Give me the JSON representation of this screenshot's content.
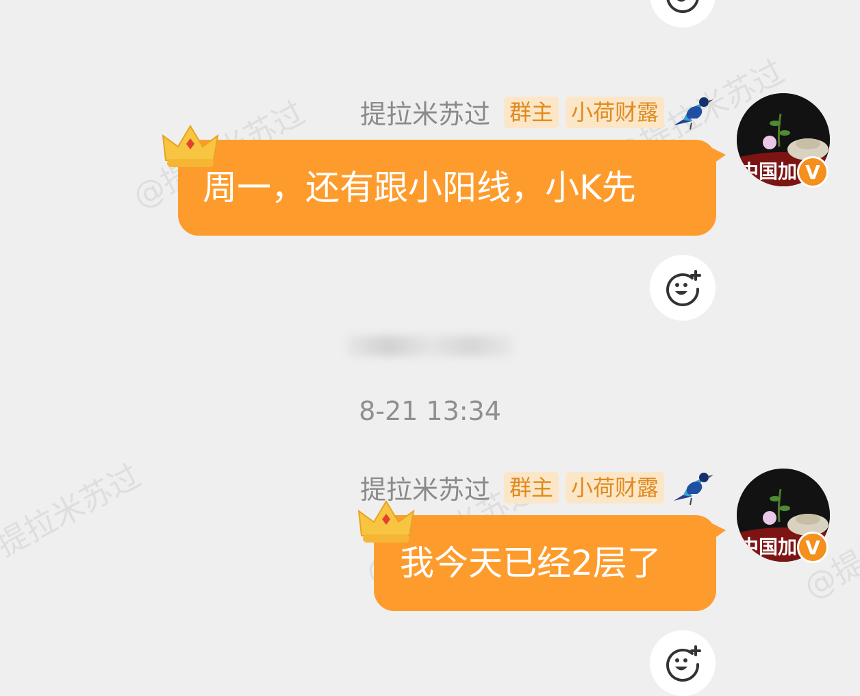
{
  "watermark": "@提拉米苏过",
  "messages": [
    {
      "sender": "提拉米苏过",
      "badge_role": "群主",
      "badge_group": "小荷财露",
      "text": "周一，还有跟小阳线，小K先",
      "avatar_caption": "中国加",
      "verified_mark": "V"
    },
    {
      "sender": "提拉米苏过",
      "badge_role": "群主",
      "badge_group": "小荷财露",
      "text": "我今天已经2层了",
      "avatar_caption": "中国加",
      "verified_mark": "V"
    }
  ],
  "timestamp": "8-21 13:34",
  "icons": {
    "reaction": "add-emoji-icon",
    "crown": "crown-icon",
    "bird": "bird-icon",
    "verified": "verified-badge-icon"
  },
  "colors": {
    "background": "#efefef",
    "bubble": "#fd9c2d",
    "badge_text": "#e08a1e",
    "badge_bg": "#fbe7c8",
    "verified": "#f58f1d"
  }
}
